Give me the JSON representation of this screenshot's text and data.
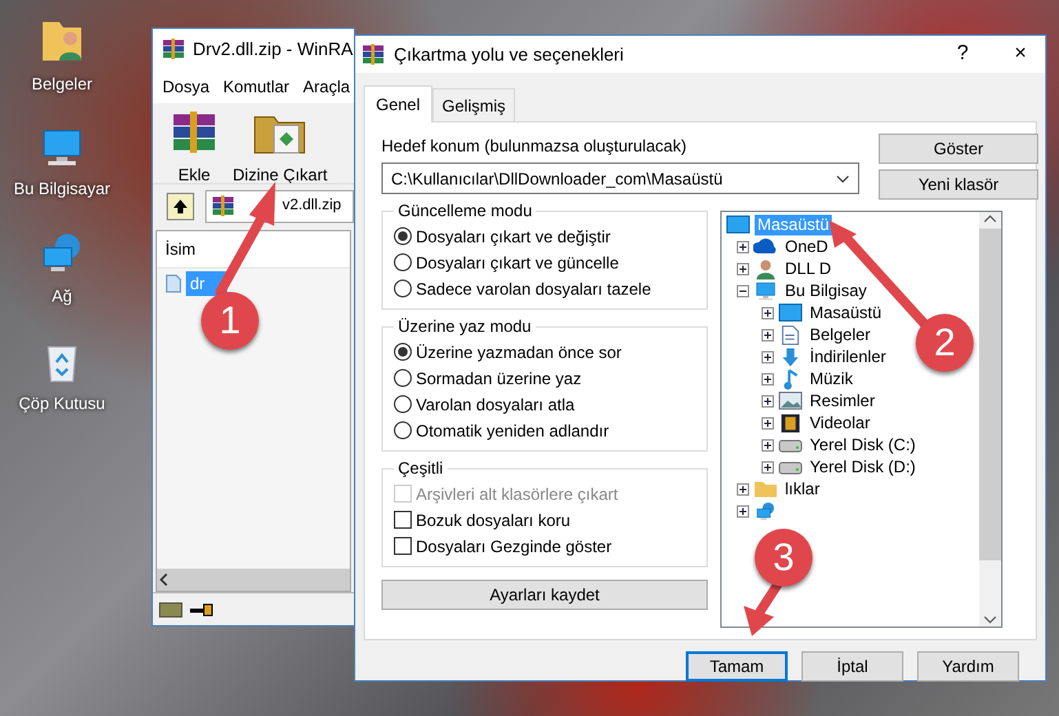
{
  "desktop_icons": [
    {
      "label": "Belgeler"
    },
    {
      "label": "Bu Bilgisayar"
    },
    {
      "label": "Ağ"
    },
    {
      "label": "Çöp Kutusu"
    }
  ],
  "archiver_window": {
    "title": "Drv2.dll.zip - WinRA",
    "menu": [
      "Dosya",
      "Komutlar",
      "Araçla"
    ],
    "toolbar": [
      {
        "label": "Ekle"
      },
      {
        "label": "Dizine Çıkart"
      }
    ],
    "path": "v2.dll.zip",
    "column": "İsim",
    "files": [
      {
        "name": "dr",
        "selected": true
      }
    ]
  },
  "dialog": {
    "title": "Çıkartma yolu ve seçenekleri",
    "help": "?",
    "close": "×",
    "tabs": [
      {
        "label": "Genel",
        "selected": true
      },
      {
        "label": "Gelişmiş",
        "selected": false
      }
    ],
    "destination_label": "Hedef konum (bulunmazsa oluşturulacak)",
    "destination": "C:\\Kullanıcılar\\DllDownloader_com\\Masaüstü",
    "side_buttons": [
      "Göster",
      "Yeni klasör"
    ],
    "groups": [
      {
        "title": "Güncelleme modu",
        "kind": "radio",
        "options": [
          {
            "label": "Dosyaları çıkart ve değiştir",
            "selected": true
          },
          {
            "label": "Dosyaları çıkart ve güncelle",
            "selected": false
          },
          {
            "label": "Sadece varolan dosyaları tazele",
            "selected": false
          }
        ]
      },
      {
        "title": "Üzerine yaz modu",
        "kind": "radio",
        "options": [
          {
            "label": "Üzerine yazmadan önce sor",
            "selected": true
          },
          {
            "label": "Sormadan üzerine yaz",
            "selected": false
          },
          {
            "label": "Varolan dosyaları atla",
            "selected": false
          },
          {
            "label": "Otomatik yeniden adlandır",
            "selected": false
          }
        ]
      },
      {
        "title": "Çeşitli",
        "kind": "check",
        "options": [
          {
            "label": "Arşivleri alt klasörlere çıkart",
            "checked": false,
            "disabled": true
          },
          {
            "label": "Bozuk dosyaları koru",
            "checked": false,
            "disabled": false
          },
          {
            "label": "Dosyaları Gezginde göster",
            "checked": false,
            "disabled": false
          }
        ]
      }
    ],
    "save_button": "Ayarları kaydet",
    "tree": [
      {
        "label": "Masaüstü",
        "kind": "desktop",
        "selected": true,
        "children": [
          {
            "label": "OneD",
            "kind": "cloud",
            "selected": false,
            "expanded": false
          },
          {
            "label": "DLL D",
            "kind": "user",
            "selected": false,
            "expanded": false
          },
          {
            "label": "Bu Bilgisay",
            "kind": "computer",
            "selected": false,
            "expanded": true,
            "children": [
              {
                "label": "Masaüstü",
                "kind": "desktop",
                "selected": false,
                "expanded": false
              },
              {
                "label": "Belgeler",
                "kind": "document",
                "selected": false,
                "expanded": false
              },
              {
                "label": "İndirilenler",
                "kind": "download",
                "selected": false,
                "expanded": false
              },
              {
                "label": "Müzik",
                "kind": "music",
                "selected": false,
                "expanded": false
              },
              {
                "label": "Resimler",
                "kind": "picture",
                "selected": false,
                "expanded": false
              },
              {
                "label": "Videolar",
                "kind": "video",
                "selected": false,
                "expanded": false
              },
              {
                "label": "Yerel Disk (C:)",
                "kind": "disk",
                "selected": false,
                "expanded": false
              },
              {
                "label": "Yerel Disk (D:)",
                "kind": "disk",
                "selected": false,
                "expanded": false
              }
            ]
          },
          {
            "label": "lıklar",
            "kind": "folder",
            "selected": false,
            "expanded": false
          },
          {
            "kind": "network",
            "selected": false,
            "expanded": false
          }
        ]
      }
    ],
    "buttons": [
      {
        "label": "Tamam",
        "focused": true
      },
      {
        "label": "İptal",
        "focused": false
      },
      {
        "label": "Yardım",
        "focused": false
      }
    ]
  },
  "annotations": [
    {
      "number": "1"
    },
    {
      "number": "2"
    },
    {
      "number": "3"
    }
  ]
}
